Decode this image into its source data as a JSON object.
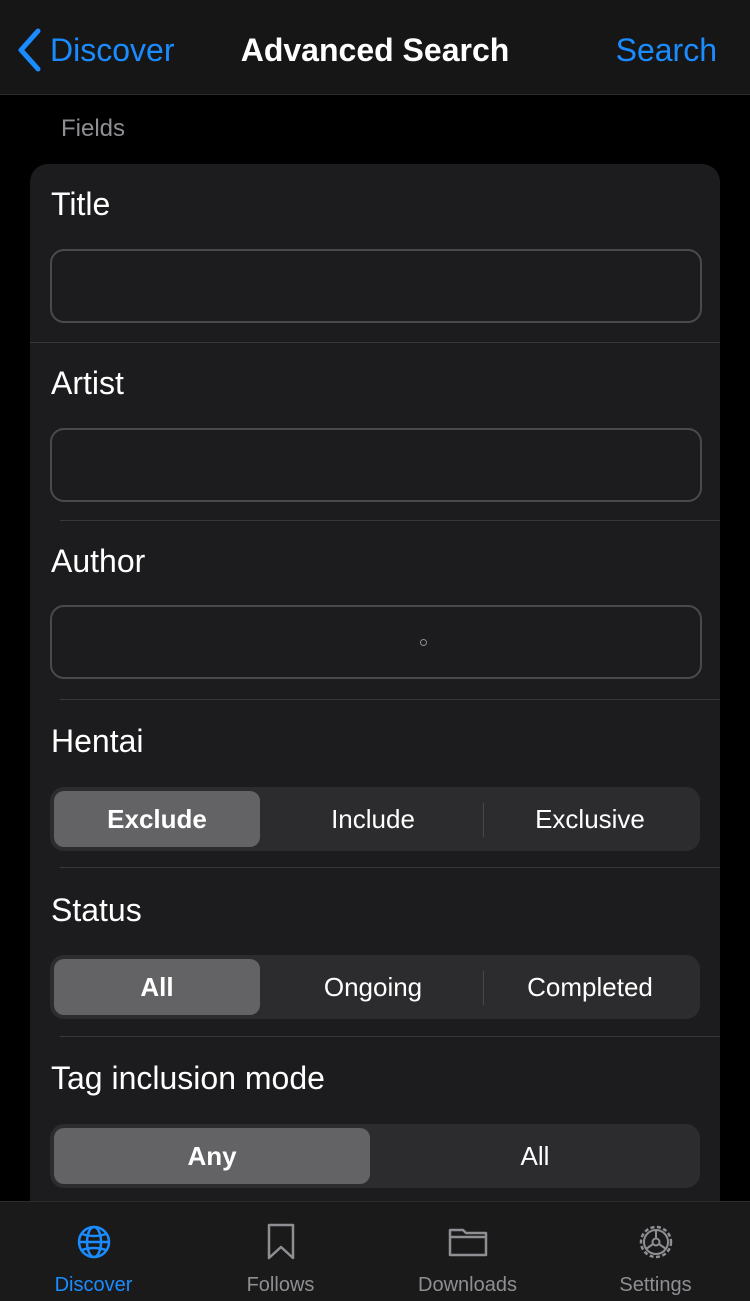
{
  "colors": {
    "accent": "#1a8cff",
    "background": "#000000",
    "card": "#1c1c1e",
    "segment_selected": "#636366",
    "inactive_tab": "#8e8e93"
  },
  "nav": {
    "back_label": "Discover",
    "back_icon": "chevron-left-icon",
    "title": "Advanced Search",
    "action_label": "Search"
  },
  "section": {
    "header": "Fields"
  },
  "fields": {
    "title": {
      "label": "Title",
      "value": "",
      "placeholder": ""
    },
    "artist": {
      "label": "Artist",
      "value": "",
      "placeholder": ""
    },
    "author": {
      "label": "Author",
      "value": "",
      "placeholder": ""
    }
  },
  "hentai": {
    "label": "Hentai",
    "options": [
      "Exclude",
      "Include",
      "Exclusive"
    ],
    "selected": "Exclude"
  },
  "status": {
    "label": "Status",
    "options": [
      "All",
      "Ongoing",
      "Completed"
    ],
    "selected": "All"
  },
  "tag_mode": {
    "label": "Tag inclusion mode",
    "options": [
      "Any",
      "All"
    ],
    "selected": "Any"
  },
  "tabbar": {
    "tabs": [
      {
        "label": "Discover",
        "icon": "globe-icon",
        "active": true
      },
      {
        "label": "Follows",
        "icon": "bookmark-icon",
        "active": false
      },
      {
        "label": "Downloads",
        "icon": "folder-icon",
        "active": false
      },
      {
        "label": "Settings",
        "icon": "gear-icon",
        "active": false
      }
    ]
  }
}
